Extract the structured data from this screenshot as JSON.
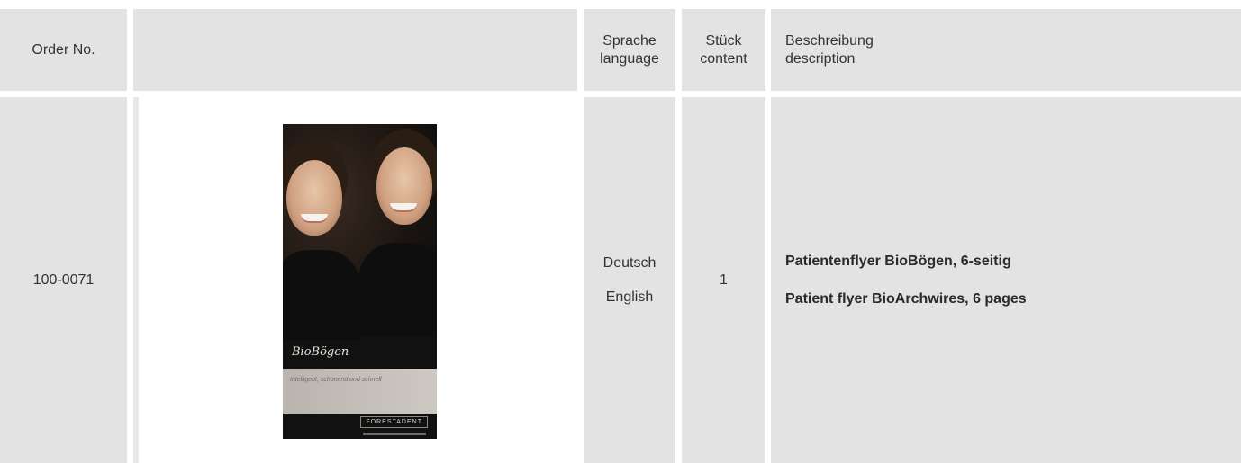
{
  "header": {
    "order_no": "Order No.",
    "image": "",
    "language_de": "Sprache",
    "language_en": "language",
    "qty_de": "Stück",
    "qty_en": "content",
    "desc_de": "Beschreibung",
    "desc_en": "description"
  },
  "rows": [
    {
      "order_no": "100-0071",
      "image": {
        "title": "BioBögen",
        "tagline": "Intelligent, schonend und schnell",
        "logo": "FORESTADENT"
      },
      "languages": [
        "Deutsch",
        "English"
      ],
      "qty": "1",
      "descriptions": [
        "Patientenflyer BioBögen, 6-seitig",
        "Patient flyer BioArchwires, 6 pages"
      ]
    }
  ],
  "colors": {
    "cell_background": "#e3e3e3",
    "flyer_background": "#111111",
    "text": "#333333"
  }
}
